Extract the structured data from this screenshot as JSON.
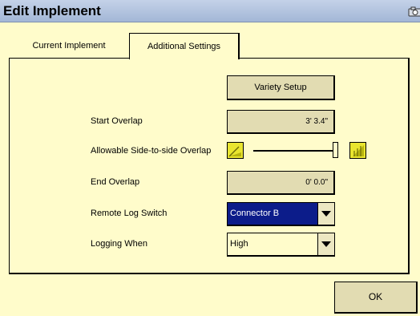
{
  "window": {
    "title": "Edit Implement"
  },
  "tabs": [
    {
      "label": "Current Implement",
      "active": false
    },
    {
      "label": "Additional Settings",
      "active": true
    }
  ],
  "variety_setup": {
    "label": "Variety Setup"
  },
  "fields": {
    "start_overlap": {
      "label": "Start Overlap",
      "value": "3' 3.4\""
    },
    "side_overlap": {
      "label": "Allowable Side-to-side Overlap",
      "level": 1.0
    },
    "end_overlap": {
      "label": "End Overlap",
      "value": "0' 0.0\""
    },
    "remote_log_switch": {
      "label": "Remote Log Switch",
      "value": "Connector B"
    },
    "logging_when": {
      "label": "Logging When",
      "value": "High"
    }
  },
  "ok_button": {
    "label": "OK"
  },
  "icons": {
    "camera": "camera-icon",
    "decrease": "overlap-decrease-icon",
    "increase": "overlap-increase-icon",
    "dropdown": "chevron-down-icon"
  },
  "colors": {
    "background": "#fffccb",
    "title_bar": "#b4c5e0",
    "button_face": "#e2dcb2",
    "selected_dropdown": "#0c1c8a",
    "icon_yellow": "#e9e52f"
  }
}
